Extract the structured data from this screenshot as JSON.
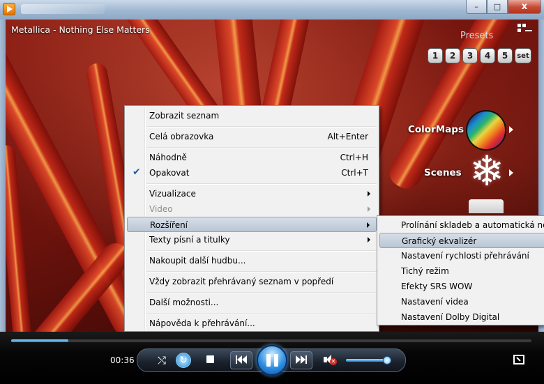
{
  "window": {
    "controls": {
      "minimize": "–",
      "maximize": "□",
      "close": "x"
    }
  },
  "now_playing": "Metallica - Nothing Else Matters",
  "visualization": {
    "presets_label": "Presets",
    "presets": [
      "1",
      "2",
      "3",
      "4",
      "5",
      "set"
    ],
    "colormaps_label": "ColorMaps",
    "scenes_label": "Scenes"
  },
  "context_menu": {
    "items": [
      {
        "label": "Zobrazit seznam",
        "shortcut": ""
      },
      {
        "label": "Celá obrazovka",
        "shortcut": "Alt+Enter"
      },
      {
        "label": "Náhodně",
        "shortcut": "Ctrl+H"
      },
      {
        "label": "Opakovat",
        "shortcut": "Ctrl+T",
        "checked": true
      },
      {
        "label": "Vizualizace",
        "submenu": true
      },
      {
        "label": "Video",
        "submenu": true,
        "disabled": true
      },
      {
        "label": "Rozšíření",
        "submenu": true,
        "highlighted": true
      },
      {
        "label": "Texty písní a titulky",
        "submenu": true
      },
      {
        "label": "Nakoupit další hudbu..."
      },
      {
        "label": "Vždy zobrazit přehrávaný seznam v popředí"
      },
      {
        "label": "Další možnosti..."
      },
      {
        "label": "Nápověda k přehrávání..."
      }
    ],
    "check_glyph": "✔"
  },
  "submenu": {
    "items": [
      {
        "label": "Prolínání skladeb a automatická normalizace hlasitosti"
      },
      {
        "label": "Grafický ekvalizér",
        "highlighted": true
      },
      {
        "label": "Nastavení rychlosti přehrávání"
      },
      {
        "label": "Tichý režim"
      },
      {
        "label": "Efekty SRS WOW"
      },
      {
        "label": "Nastavení videa"
      },
      {
        "label": "Nastavení Dolby Digital"
      }
    ]
  },
  "player": {
    "elapsed": "00:36",
    "seek_progress": 0.11,
    "volume_level": 0.92,
    "muted": true,
    "repeat_on": true,
    "state": "playing",
    "icons": {
      "shuffle": "shuffle-icon",
      "repeat": "repeat-icon",
      "stop": "stop-icon",
      "previous": "previous-icon",
      "pause": "pause-icon",
      "next": "next-icon",
      "mute": "mute-icon",
      "fullscreen": "fullscreen-icon"
    },
    "shuffle_glyph": "⤭",
    "repeat_glyph": "↻"
  },
  "colors": {
    "accent": "#2a86d6",
    "menu_highlight": "#b9c6d4",
    "background": "#6a120c"
  }
}
